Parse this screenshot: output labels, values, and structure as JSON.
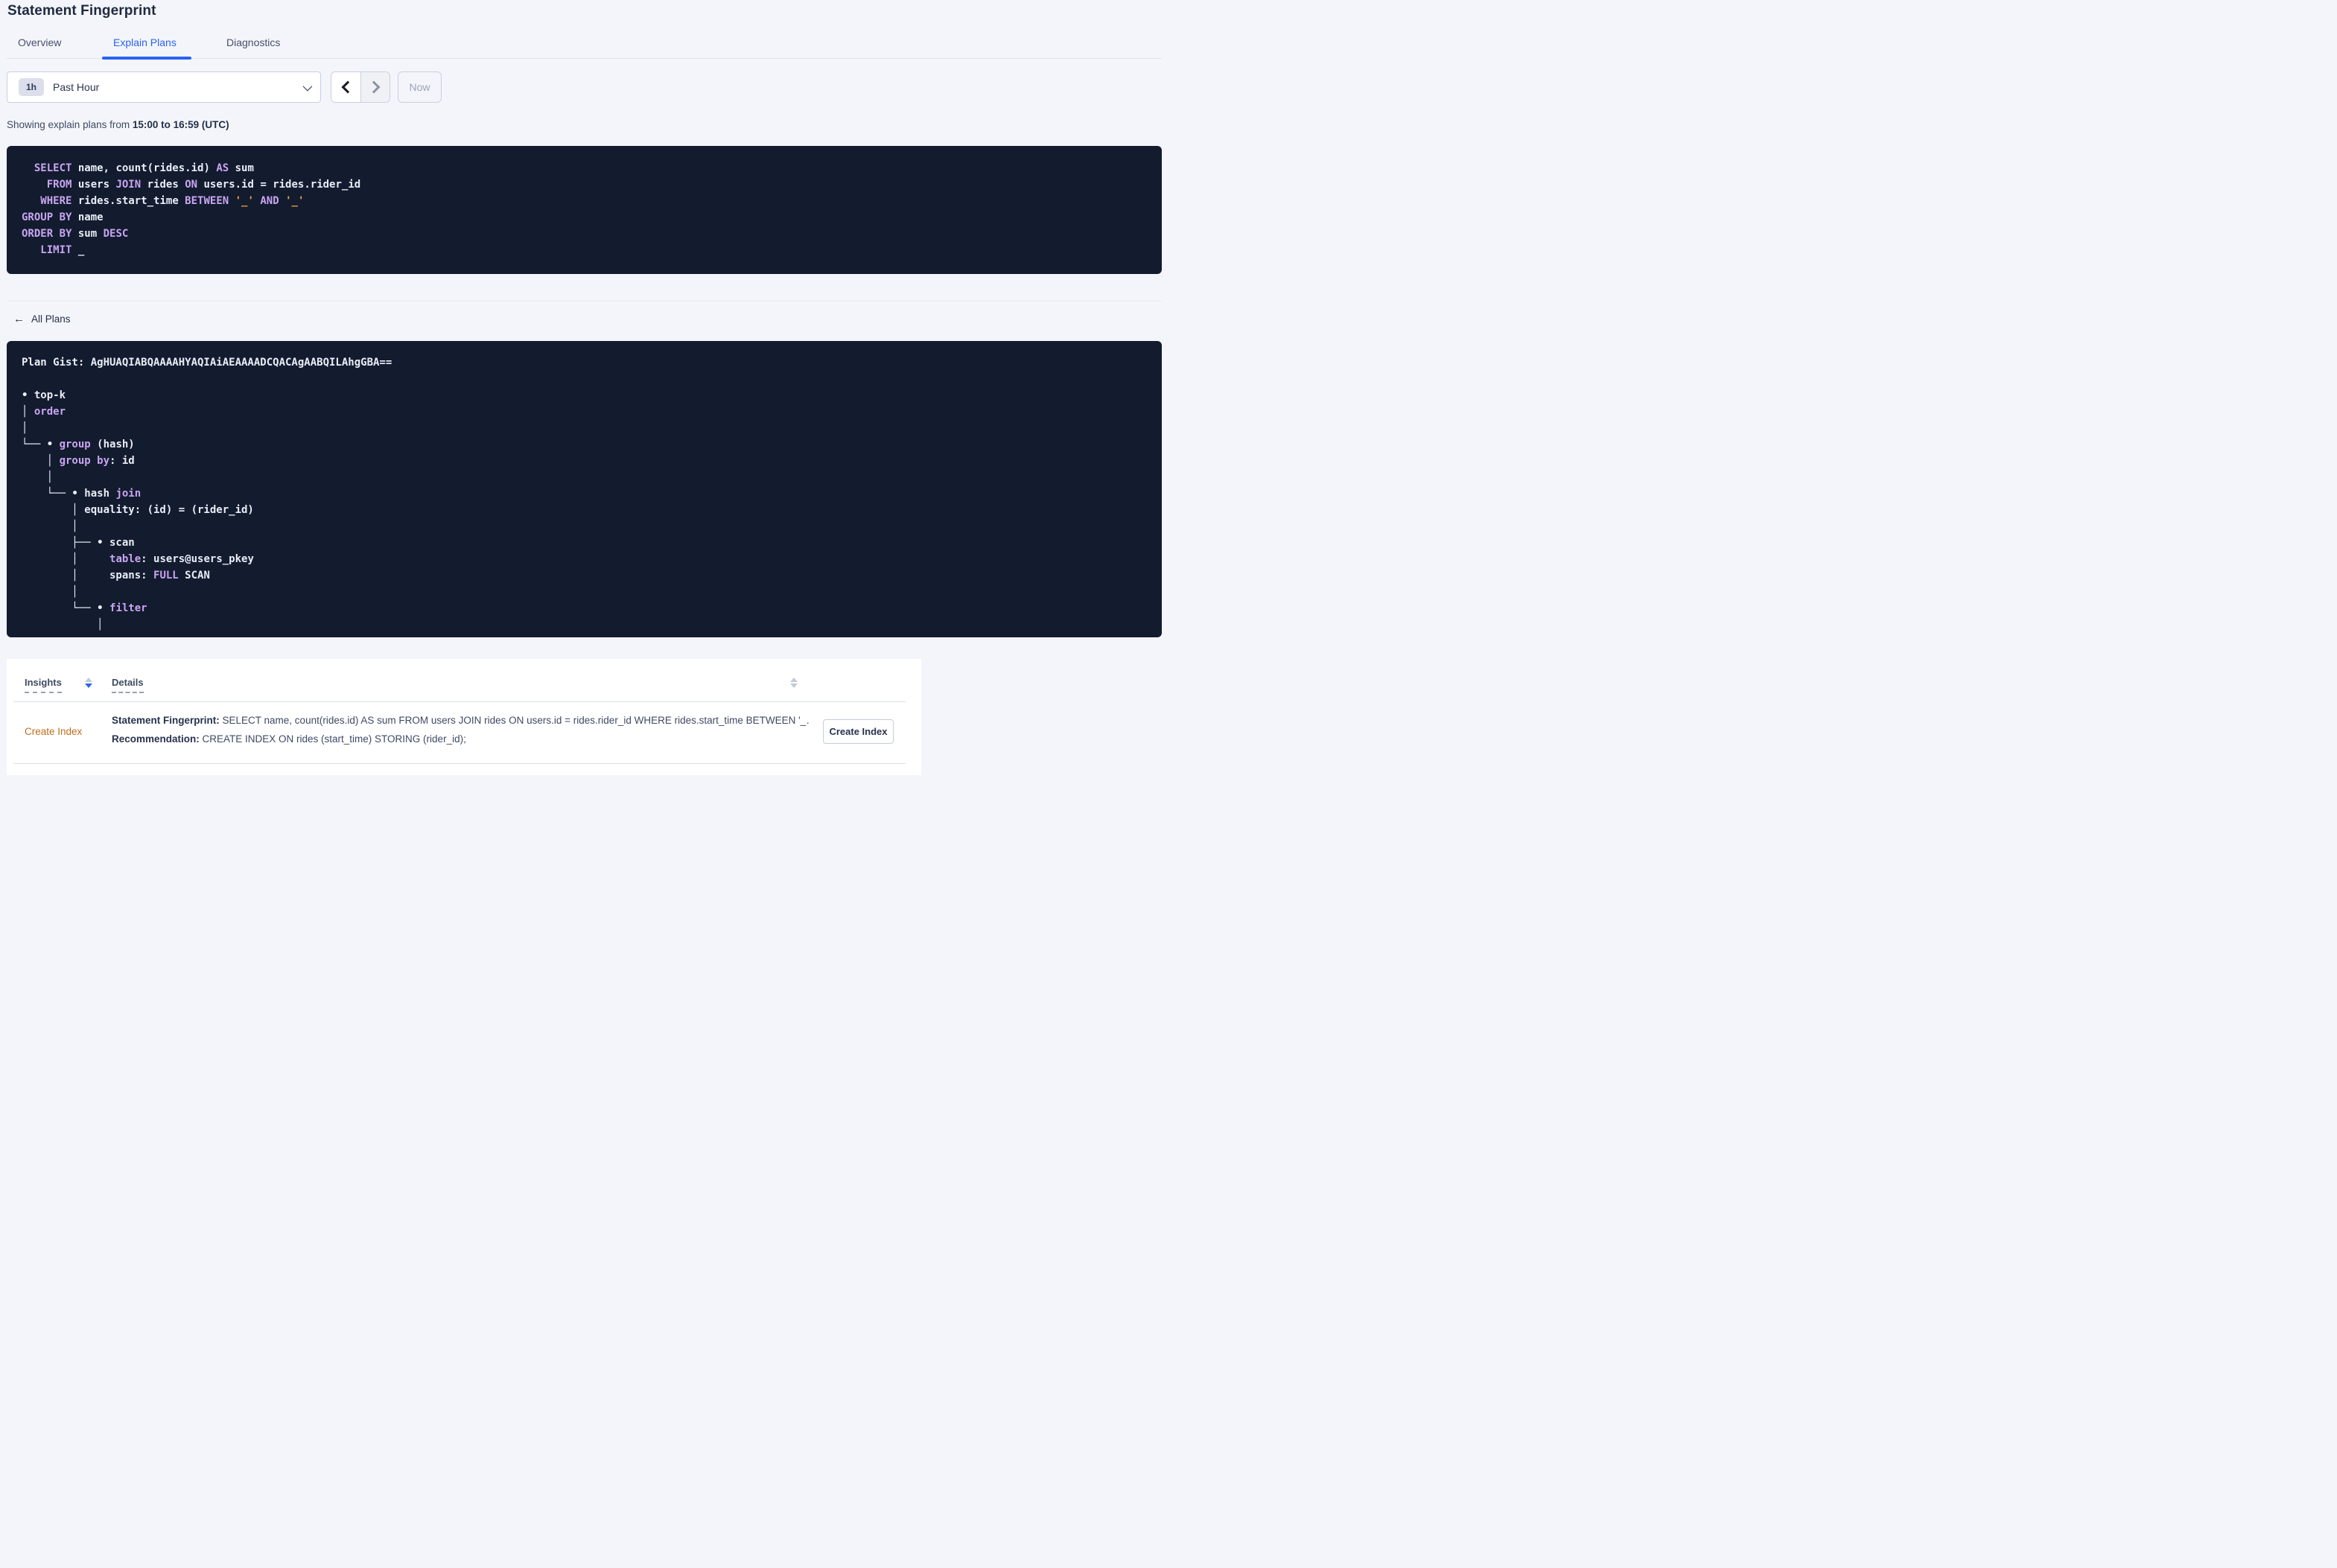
{
  "page": {
    "title": "Statement Fingerprint"
  },
  "tabs": [
    {
      "label": "Overview",
      "active": false
    },
    {
      "label": "Explain Plans",
      "active": true
    },
    {
      "label": "Diagnostics",
      "active": false
    }
  ],
  "time_selector": {
    "badge": "1h",
    "label": "Past Hour",
    "now_label": "Now"
  },
  "caption": {
    "prefix": "Showing explain plans from ",
    "range": "15:00 to 16:59 (UTC)"
  },
  "colors": {
    "accent_blue": "#2962f4",
    "panel_navy": "#131b2f",
    "keyword_purple": "#c8a5f0",
    "literal_orange": "#ee9d3f",
    "insight_link_orange": "#c26d1a"
  },
  "sql": {
    "lines": [
      [
        [
          "t",
          "  "
        ],
        [
          "k",
          "SELECT"
        ],
        [
          "t",
          " name, count(rides.id) "
        ],
        [
          "k",
          "AS"
        ],
        [
          "t",
          " sum"
        ]
      ],
      [
        [
          "t",
          "    "
        ],
        [
          "k",
          "FROM"
        ],
        [
          "t",
          " users "
        ],
        [
          "k",
          "JOIN"
        ],
        [
          "t",
          " rides "
        ],
        [
          "k",
          "ON"
        ],
        [
          "t",
          " users.id = rides.rider_id"
        ]
      ],
      [
        [
          "t",
          "   "
        ],
        [
          "k",
          "WHERE"
        ],
        [
          "t",
          " rides.start_time "
        ],
        [
          "k",
          "BETWEEN"
        ],
        [
          "t",
          " "
        ],
        [
          "l",
          "'_'"
        ],
        [
          "t",
          " "
        ],
        [
          "k",
          "AND"
        ],
        [
          "t",
          " "
        ],
        [
          "l",
          "'_'"
        ]
      ],
      [
        [
          "k",
          "GROUP BY"
        ],
        [
          "t",
          " name"
        ]
      ],
      [
        [
          "k",
          "ORDER BY"
        ],
        [
          "t",
          " sum "
        ],
        [
          "k",
          "DESC"
        ]
      ],
      [
        [
          "t",
          "   "
        ],
        [
          "k",
          "LIMIT"
        ],
        [
          "t",
          " _"
        ]
      ]
    ]
  },
  "plans": {
    "back_label": "All Plans",
    "back_arrow": "←",
    "gist": "Plan Gist: AgHUAQIABQAAAAHYAQIAiAEAAAADCQACAgAABQILAhgGBA==",
    "lines": [
      [
        [
          "t",
          "Plan Gist: AgHUAQIABQAAAAHYAQIAiAEAAAADCQACAgAABQILAhgGBA=="
        ]
      ],
      [],
      [
        [
          "t",
          "• top-k"
        ]
      ],
      [
        [
          "t",
          "│ "
        ],
        [
          "k",
          "order"
        ]
      ],
      [
        [
          "t",
          "│"
        ]
      ],
      [
        [
          "t",
          "└── • "
        ],
        [
          "k",
          "group"
        ],
        [
          "t",
          " (hash)"
        ]
      ],
      [
        [
          "t",
          "    │ "
        ],
        [
          "k",
          "group by"
        ],
        [
          "t",
          ": id"
        ]
      ],
      [
        [
          "t",
          "    │"
        ]
      ],
      [
        [
          "t",
          "    └── • hash "
        ],
        [
          "k",
          "join"
        ]
      ],
      [
        [
          "t",
          "        │ equality: (id) = (rider_id)"
        ]
      ],
      [
        [
          "t",
          "        │"
        ]
      ],
      [
        [
          "t",
          "        ├── • scan"
        ]
      ],
      [
        [
          "t",
          "        │     "
        ],
        [
          "k",
          "table"
        ],
        [
          "t",
          ": users@users_pkey"
        ]
      ],
      [
        [
          "t",
          "        │     spans: "
        ],
        [
          "k",
          "FULL"
        ],
        [
          "t",
          " SCAN"
        ]
      ],
      [
        [
          "t",
          "        │"
        ]
      ],
      [
        [
          "t",
          "        └── • "
        ],
        [
          "k",
          "filter"
        ]
      ],
      [
        [
          "t",
          "            │"
        ]
      ]
    ]
  },
  "insights_table": {
    "columns": [
      {
        "label": "Insights",
        "sort": "desc"
      },
      {
        "label": "Details",
        "sort": "none"
      }
    ],
    "row": {
      "insight_link": "Create Index",
      "details": [
        {
          "label": "Statement Fingerprint:",
          "text": " SELECT name, count(rides.id) AS sum FROM users JOIN rides ON users.id = rides.rider_id WHERE rides.start_time BETWEEN '_…"
        },
        {
          "label": "Recommendation:",
          "text": " CREATE INDEX ON rides (start_time) STORING (rider_id);"
        }
      ],
      "action_label": "Create Index"
    }
  }
}
